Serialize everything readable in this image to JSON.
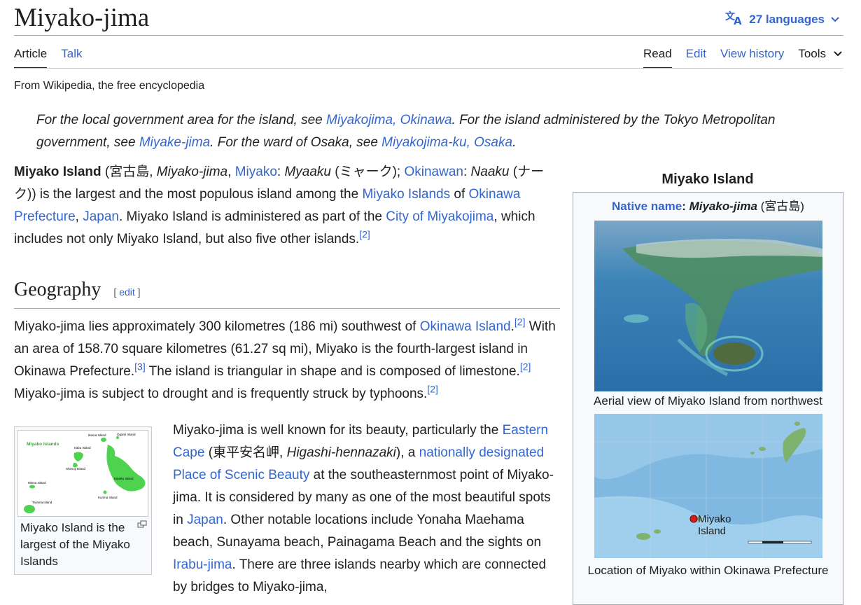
{
  "page": {
    "title": "Miyako-jima",
    "languages_label": "27 languages",
    "tagline": "From Wikipedia, the free encyclopedia"
  },
  "tabs": {
    "article": "Article",
    "talk": "Talk",
    "read": "Read",
    "edit": "Edit",
    "view_history": "View history",
    "tools": "Tools"
  },
  "hatnote": {
    "t1": "For the local government area for the island, see ",
    "l1": "Miyakojima, Okinawa",
    "t2": ". For the island administered by the Tokyo Metropolitan government, see ",
    "l2": "Miyake-jima",
    "t3": ". For the ward of Osaka, see ",
    "l3": "Miyakojima-ku, Osaka",
    "t4": "."
  },
  "lead": {
    "b1": "Miyako Island",
    "t1": " (宮古島, ",
    "i1": "Miyako-jima",
    "t2": ", ",
    "l1": "Miyako",
    "t3": ": ",
    "i2": "Myaaku",
    "t4": " (ミャーク); ",
    "l2": "Okinawan",
    "t5": ": ",
    "i3": "Naaku",
    "t6": " (ナーク)) is the largest and the most populous island among the ",
    "l3": "Miyako Islands",
    "t7": " of ",
    "l4": "Okinawa Prefecture",
    "t8": ", ",
    "l5": "Japan",
    "t9": ". Miyako Island is administered as part of the ",
    "l6": "City of Miyakojima",
    "t10": ", which includes not only Miyako Island, but also five other islands.",
    "r1": "[2]"
  },
  "geography": {
    "heading": "Geography",
    "edit_open": "[ ",
    "edit_link": "edit",
    "edit_close": " ]",
    "p1": {
      "t1": "Miyako-jima lies approximately 300 kilometres (186 mi) southwest of ",
      "l1": "Okinawa Island",
      "t2": ".",
      "r1": "[2]",
      "t3": " With an area of 158.70 square kilometres (61.27 sq mi), Miyako is the fourth-largest island in Okinawa Prefecture.",
      "r2": "[3]",
      "t4": " The island is triangular in shape and is composed of limestone.",
      "r3": "[2]",
      "t5": " Miyako-jima is subject to drought and is frequently struck by typhoons.",
      "r4": "[2]"
    },
    "p2": {
      "t1": "Miyako-jima is well known for its beauty, particularly the ",
      "l1": "Eastern Cape",
      "t2": " (東平安名岬, ",
      "i1": "Higashi-hennazaki",
      "t3": "), a ",
      "l2": "nationally designated Place of Scenic Beauty",
      "t4": " at the southeasternmost point of Miyako-jima. It is considered by many as one of the most beautiful spots in ",
      "l3": "Japan",
      "t5": ". Other notable locations include Yonaha Maehama beach, Sunayama beach, Painagama Beach and the sights on ",
      "l4": "Irabu-jima",
      "t6": ". There are three islands nearby which are connected by bridges to Miyako-jima,"
    }
  },
  "thumb": {
    "caption": "Miyako Island is the largest of the Miyako Islands",
    "map_title": "Miyako Islands",
    "labels": [
      "Ikema Island",
      "Ogami Island",
      "Irabu Island",
      "Shimoji Island",
      "Miyako Island",
      "Minna Island",
      "Kurima Island",
      "Tarama Island"
    ]
  },
  "infobox": {
    "title": "Miyako Island",
    "native_label": "Native name",
    "native_sep": ": ",
    "native_value": "Miyako-jima",
    "native_paren": " (宮古島)",
    "photo_caption": "Aerial view of Miyako Island from northwest",
    "map_marker_label_1": "Miyako",
    "map_marker_label_2": "Island",
    "map_caption": "Location of Miyako within Okinawa Prefecture"
  },
  "colors": {
    "link": "#3366cc",
    "text": "#202122",
    "island_green": "#4ed34e",
    "sea": "#2f8ec6"
  }
}
